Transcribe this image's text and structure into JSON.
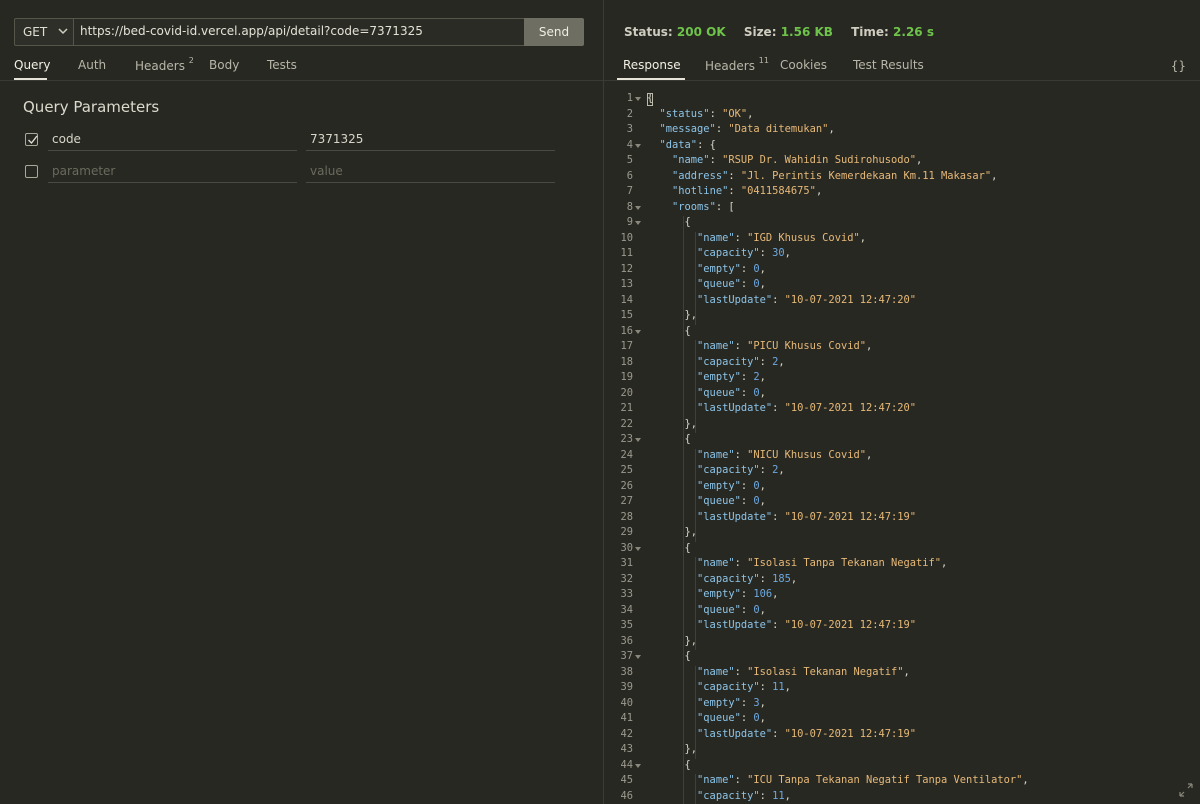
{
  "request": {
    "method": "GET",
    "url": "https://bed-covid-id.vercel.app/api/detail?code=7371325",
    "send_label": "Send",
    "tabs": [
      {
        "label": "Query"
      },
      {
        "label": "Auth"
      },
      {
        "label": "Headers",
        "badge": "2"
      },
      {
        "label": "Body"
      },
      {
        "label": "Tests"
      }
    ],
    "query_title": "Query Parameters",
    "params": [
      {
        "checked": true,
        "name": "code",
        "value": "7371325"
      }
    ],
    "new_param": {
      "name_placeholder": "parameter",
      "value_placeholder": "value"
    }
  },
  "response": {
    "status_label": "Status:",
    "status_value": "200 OK",
    "size_label": "Size:",
    "size_value": "1.56 KB",
    "time_label": "Time:",
    "time_value": "2.26 s",
    "tabs": [
      {
        "label": "Response"
      },
      {
        "label": "Headers",
        "badge": "11"
      },
      {
        "label": "Cookies"
      },
      {
        "label": "Test Results"
      }
    ],
    "format_icon_label": "{}",
    "lines": [
      "{",
      "  \"status\": \"OK\",",
      "  \"message\": \"Data ditemukan\",",
      "  \"data\": {",
      "    \"name\": \"RSUP Dr. Wahidin Sudirohusodo\",",
      "    \"address\": \"Jl. Perintis Kemerdekaan Km.11 Makasar\",",
      "    \"hotline\": \"0411584675\",",
      "    \"rooms\": [",
      "      {",
      "        \"name\": \"IGD Khusus Covid\",",
      "        \"capacity\": 30,",
      "        \"empty\": 0,",
      "        \"queue\": 0,",
      "        \"lastUpdate\": \"10-07-2021 12:47:20\"",
      "      },",
      "      {",
      "        \"name\": \"PICU Khusus Covid\",",
      "        \"capacity\": 2,",
      "        \"empty\": 2,",
      "        \"queue\": 0,",
      "        \"lastUpdate\": \"10-07-2021 12:47:20\"",
      "      },",
      "      {",
      "        \"name\": \"NICU Khusus Covid\",",
      "        \"capacity\": 2,",
      "        \"empty\": 0,",
      "        \"queue\": 0,",
      "        \"lastUpdate\": \"10-07-2021 12:47:19\"",
      "      },",
      "      {",
      "        \"name\": \"Isolasi Tanpa Tekanan Negatif\",",
      "        \"capacity\": 185,",
      "        \"empty\": 106,",
      "        \"queue\": 0,",
      "        \"lastUpdate\": \"10-07-2021 12:47:19\"",
      "      },",
      "      {",
      "        \"name\": \"Isolasi Tekanan Negatif\",",
      "        \"capacity\": 11,",
      "        \"empty\": 3,",
      "        \"queue\": 0,",
      "        \"lastUpdate\": \"10-07-2021 12:47:19\"",
      "      },",
      "      {",
      "        \"name\": \"ICU Tanpa Tekanan Negatif Tanpa Ventilator\",",
      "        \"capacity\": 11,"
    ],
    "fold_lines": [
      1,
      4,
      8,
      9,
      16,
      23,
      30,
      37,
      44
    ]
  },
  "colors": {
    "status_ok": "#6ec44a",
    "json_key": "#8cc4e8",
    "json_string": "#e6b978",
    "json_number": "#6ea8e0"
  }
}
